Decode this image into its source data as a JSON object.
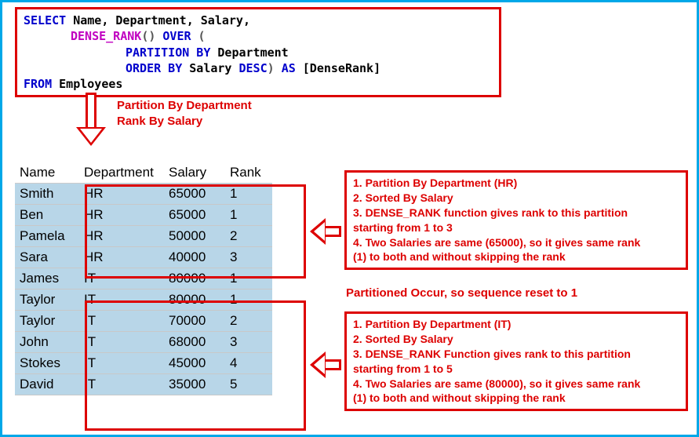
{
  "sql": {
    "line1": {
      "select": "SELECT",
      "fields": " Name, Department, Salary,"
    },
    "line2": {
      "func": "DENSE_RANK",
      "paren": "() ",
      "over": "OVER",
      "open": " ("
    },
    "line3": {
      "partition": "PARTITION BY",
      "field": " Department"
    },
    "line4": {
      "orderby": "ORDER BY",
      "field": " Salary ",
      "desc": "DESC",
      "close": ") ",
      "as": "AS",
      "alias": " [DenseRank]"
    },
    "line5": {
      "from": "FROM",
      "table": " Employees"
    }
  },
  "arrow_label": {
    "l1": "Partition By Department",
    "l2": "Rank By Salary"
  },
  "table": {
    "headers": [
      "Name",
      "Department",
      "Salary",
      "Rank"
    ],
    "rows": [
      [
        "Smith",
        "HR",
        "65000",
        "1"
      ],
      [
        "Ben",
        "HR",
        "65000",
        "1"
      ],
      [
        "Pamela",
        "HR",
        "50000",
        "2"
      ],
      [
        "Sara",
        "HR",
        "40000",
        "3"
      ],
      [
        "James",
        "IT",
        "80000",
        "1"
      ],
      [
        "Taylor",
        "IT",
        "80000",
        "1"
      ],
      [
        "Taylor",
        "IT",
        "70000",
        "2"
      ],
      [
        "John",
        "IT",
        "68000",
        "3"
      ],
      [
        "Stokes",
        "IT",
        "45000",
        "4"
      ],
      [
        "David",
        "IT",
        "35000",
        "5"
      ]
    ]
  },
  "info1": {
    "l1": "1. Partition By Department (HR)",
    "l2": "2. Sorted By Salary",
    "l3": "3. DENSE_RANK function gives rank to this partition",
    "l4": "starting from 1 to 3",
    "l5": "4. Two Salaries are same (65000), so it gives same rank",
    "l6": "(1) to both and without skipping the rank"
  },
  "partition_note": "Partitioned Occur, so sequence reset to 1",
  "info2": {
    "l1": "1. Partition By Department (IT)",
    "l2": "2. Sorted By Salary",
    "l3": "3. DENSE_RANK Function gives rank to this partition",
    "l4": "starting from 1 to 5",
    "l5": "4. Two Salaries are same (80000), so it gives same rank",
    "l6": "(1) to both and without skipping the rank"
  }
}
